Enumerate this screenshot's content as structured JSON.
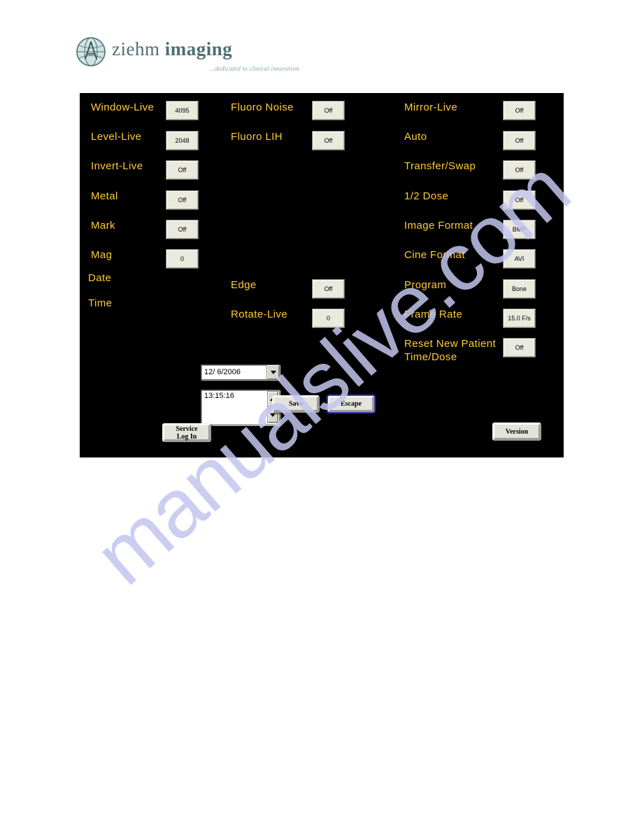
{
  "logo": {
    "word_light": "ziehm ",
    "word_bold": "imaging",
    "tagline": "...dedicated to clinical innovation",
    "brand_color": "#4f6f72"
  },
  "watermark": {
    "text": "manualslive.com",
    "color": "#c3c6ee"
  },
  "panel": {
    "background": "#000000",
    "label_color": "#ffcc33",
    "button_face": "#e9e9dd",
    "columns": {
      "left": [
        {
          "label": "Window-Live",
          "value": "4095"
        },
        {
          "label": "Level-Live",
          "value": "2048"
        },
        {
          "label": "Invert-Live",
          "value": "Off"
        },
        {
          "label": "Metal",
          "value": "Off"
        },
        {
          "label": "Mark",
          "value": "Off"
        },
        {
          "label": "Mag",
          "value": "0"
        }
      ],
      "middle_top": [
        {
          "label": "Fluoro Noise",
          "value": "Off"
        },
        {
          "label": "Fluoro LIH",
          "value": "Off"
        }
      ],
      "middle_bottom": [
        {
          "label": "Edge",
          "value": "Off"
        },
        {
          "label": "Rotate-Live",
          "value": "0"
        }
      ],
      "right": [
        {
          "label": "Mirror-Live",
          "value": "Off"
        },
        {
          "label": "Auto",
          "value": "Off"
        },
        {
          "label": "Transfer/Swap",
          "value": "Off"
        },
        {
          "label": "1/2 Dose",
          "value": "Off"
        },
        {
          "label": "Image Format",
          "value": "BMP"
        },
        {
          "label": "Cine Format",
          "value": "AVI"
        },
        {
          "label": "Program",
          "value": "Bone"
        },
        {
          "label": "Frame Rate",
          "value": "15.0 F/s"
        }
      ],
      "right_last": {
        "label_line1": "Reset New Patient",
        "label_line2": "Time/Dose",
        "value": "Off"
      }
    },
    "date_field": {
      "label": "Date",
      "value": "12/ 6/2006",
      "dropdown_icon": "chevron-down-icon"
    },
    "time_field": {
      "label": "Time",
      "value": "13:15:16",
      "spinner_up_icon": "triangle-up-icon",
      "spinner_down_icon": "triangle-down-icon"
    },
    "buttons": {
      "save": "Save",
      "escape": "Escape",
      "service_login_line1": "Service",
      "service_login_line2": "Log In",
      "version": "Version",
      "version_subtext": "- - - -"
    }
  }
}
